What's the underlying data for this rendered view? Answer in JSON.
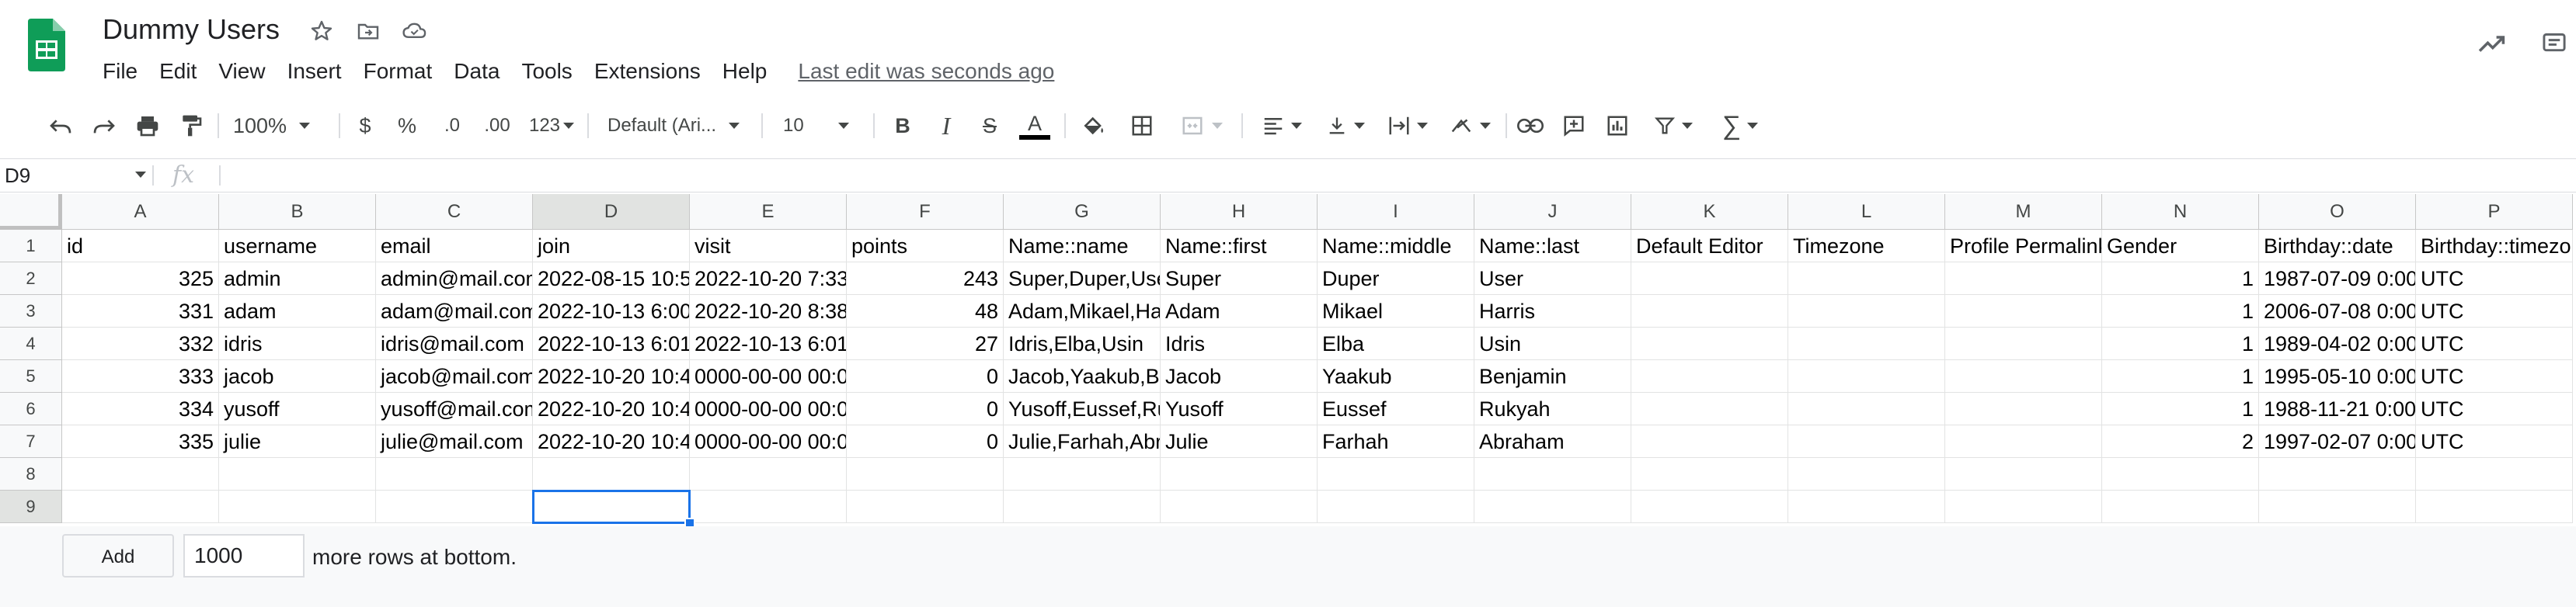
{
  "header": {
    "title": "Dummy Users",
    "menu": [
      "File",
      "Edit",
      "View",
      "Insert",
      "Format",
      "Data",
      "Tools",
      "Extensions",
      "Help"
    ],
    "last_edit": "Last edit was seconds ago"
  },
  "toolbar": {
    "zoom": "100%",
    "currency": "$",
    "percent": "%",
    "decrease_decimal": ".0",
    "increase_decimal": ".00",
    "more_formats": "123",
    "font_family": "Default (Ari...",
    "font_size": "10",
    "bold": "B",
    "italic": "I",
    "strikethrough": "S",
    "text_color": "A"
  },
  "formula_bar": {
    "name_box": "D9",
    "fx": "fx",
    "content": ""
  },
  "grid": {
    "columns": [
      "A",
      "B",
      "C",
      "D",
      "E",
      "F",
      "G",
      "H",
      "I",
      "J",
      "K",
      "L",
      "M",
      "N",
      "O",
      "P"
    ],
    "selected_column": "D",
    "row_numbers": [
      "1",
      "2",
      "3",
      "4",
      "5",
      "6",
      "7",
      "8",
      "9"
    ],
    "selected_row": "9",
    "rows": [
      [
        "id",
        "username",
        "email",
        "join",
        "visit",
        "points",
        "Name::name",
        "Name::first",
        "Name::middle",
        "Name::last",
        "Default Editor",
        "Timezone",
        "Profile Permalink",
        "Gender",
        "Birthday::date",
        "Birthday::timezone"
      ],
      [
        "325",
        "admin",
        "admin@mail.com",
        "2022-08-15 10:5",
        "2022-10-20 7:33",
        "243",
        "Super,Duper,Use",
        "Super",
        "Duper",
        "User",
        "",
        "",
        "",
        "1",
        "1987-07-09 0:00",
        "UTC"
      ],
      [
        "331",
        "adam",
        "adam@mail.com",
        "2022-10-13 6:00",
        "2022-10-20 8:38",
        "48",
        "Adam,Mikael,Ha",
        "Adam",
        "Mikael",
        "Harris",
        "",
        "",
        "",
        "1",
        "2006-07-08 0:00",
        "UTC"
      ],
      [
        "332",
        "idris",
        "idris@mail.com",
        "2022-10-13 6:01",
        "2022-10-13 6:01",
        "27",
        "Idris,Elba,Usin",
        "Idris",
        "Elba",
        "Usin",
        "",
        "",
        "",
        "1",
        "1989-04-02 0:00",
        "UTC"
      ],
      [
        "333",
        "jacob",
        "jacob@mail.com",
        "2022-10-20 10:4",
        "0000-00-00 00:0",
        "0",
        "Jacob,Yaakub,B",
        "Jacob",
        "Yaakub",
        "Benjamin",
        "",
        "",
        "",
        "1",
        "1995-05-10 0:00",
        "UTC"
      ],
      [
        "334",
        "yusoff",
        "yusoff@mail.com",
        "2022-10-20 10:4",
        "0000-00-00 00:0",
        "0",
        "Yusoff,Eussef,Ru",
        "Yusoff",
        "Eussef",
        "Rukyah",
        "",
        "",
        "",
        "1",
        "1988-11-21 0:00",
        "UTC"
      ],
      [
        "335",
        "julie",
        "julie@mail.com",
        "2022-10-20 10:4",
        "0000-00-00 00:0",
        "0",
        "Julie,Farhah,Abr",
        "Julie",
        "Farhah",
        "Abraham",
        "",
        "",
        "",
        "2",
        "1997-02-07 0:00",
        "UTC"
      ],
      [
        "",
        "",
        "",
        "",
        "",
        "",
        "",
        "",
        "",
        "",
        "",
        "",
        "",
        "",
        "",
        ""
      ],
      [
        "",
        "",
        "",
        "",
        "",
        "",
        "",
        "",
        "",
        "",
        "",
        "",
        "",
        "",
        "",
        ""
      ]
    ],
    "numeric_columns": [
      0,
      5,
      13
    ]
  },
  "footer": {
    "add_button": "Add",
    "rows_value": "1000",
    "more_rows_label": "more rows at bottom."
  },
  "colors": {
    "accent": "#1a73e8",
    "sheets_green": "#0f9d58"
  },
  "icons": [
    "sheets-logo-icon",
    "star-icon",
    "move-to-folder-icon",
    "cloud-status-icon",
    "trending-icon",
    "comments-icon",
    "undo-icon",
    "redo-icon",
    "print-icon",
    "paint-format-icon",
    "fill-color-icon",
    "borders-icon",
    "merge-cells-icon",
    "horizontal-align-icon",
    "vertical-align-icon",
    "text-wrap-icon",
    "text-rotation-icon",
    "insert-link-icon",
    "insert-comment-icon",
    "insert-chart-icon",
    "filter-icon",
    "functions-icon"
  ]
}
